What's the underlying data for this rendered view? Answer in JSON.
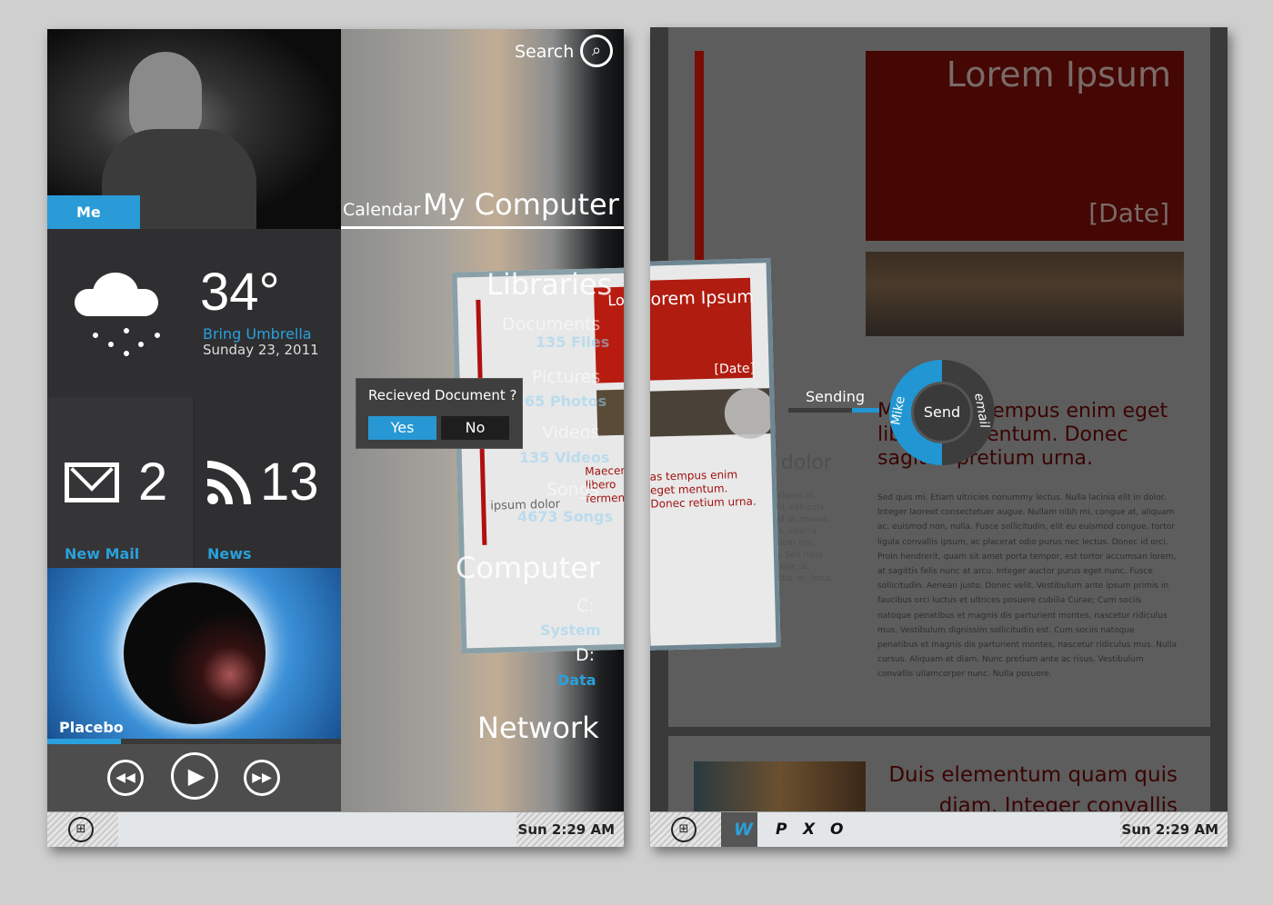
{
  "left_device": {
    "me_tile": {
      "label": "Me"
    },
    "weather": {
      "temperature": "34°",
      "tip": "Bring Umbrella",
      "date": "Sunday 23, 2011",
      "icon": "snow-cloud-icon"
    },
    "mail": {
      "count": "2",
      "label": "New Mail",
      "icon": "mail-icon"
    },
    "news": {
      "count": "13",
      "label": "News",
      "icon": "rss-icon"
    },
    "music": {
      "label": "Placebo",
      "progress_percent": 25
    },
    "search": {
      "label": "Search"
    },
    "header": {
      "calendar": "Calendar",
      "my_computer": "My Computer"
    },
    "libraries": {
      "title": "Libraries",
      "items": [
        {
          "name": "Documents",
          "count": "135 Files"
        },
        {
          "name": "Pictures",
          "count": "65 Photos"
        },
        {
          "name": "Videos",
          "count": "135 Videos"
        },
        {
          "name": "Songs",
          "count": "4673 Songs"
        }
      ]
    },
    "computer": {
      "title": "Computer",
      "drives": [
        {
          "name": "C:",
          "label": "System"
        },
        {
          "name": "D:",
          "label": "Data"
        }
      ]
    },
    "network": "Network",
    "dialog": {
      "question": "Recieved Document ?",
      "yes": "Yes",
      "no": "No"
    },
    "thumb": {
      "title": "Lorem Ipsum",
      "subhead": "Maecenas libero fermentum sagittis pretium",
      "side": "ipsum dolor"
    },
    "taskbar": {
      "clock": "Sun 2:29 AM"
    }
  },
  "right_device": {
    "doc": {
      "title": "Lorem Ipsum",
      "date": "[Date]",
      "heading": "Maecenas tempus enim eget libero fermentum. Donec sagittis pretium urna.",
      "side_heading": "ipsum dolor",
      "side_text": "aliquam ac, aliquet id, consequat sed, vehicula risus, euismod ut, massa. Nulla id lectus. viverra. Morbi vestibulum nisl, massa. lorem. Sed risus justo, scelerisque ut, ultrices a, auctor et, lacus. Duis a orci.",
      "body": "Sed quis mi. Etiam ultricies nonummy lectus. Nulla lacinia elit in dolor. Integer laoreet consectetuer augue. Nullam nibh mi, congue at, aliquam ac, euismod non, nulla. Fusce sollicitudin, elit eu euismod congue, tortor ligula convallis ipsum, ac placerat odio purus nec lectus. Donec id orci. Proin hendrerit, quam sit amet porta tempor, est tortor accumsan lorem, at sagittis felis nunc at arcu. Integer auctor purus eget nunc. Fusce sollicitudin. Aenean justo. Donec velit. Vestibulum ante ipsum primis in faucibus orci luctus et ultrices posuere cubilia Curae; Cum sociis natoque penatibus et magnis dis parturient montes, nascetur ridiculus mus. Vestibulum dignissim sollicitudin est. Cum sociis natoque penatibus et magnis dis parturient montes, nascetur ridiculus mus. Nulla cursus. Aliquam et diam. Nunc pretium ante ac risus. Vestibulum convallis ullamcorper nunc. Nulla posuere.",
      "next_heading": "Duis elementum quam quis diam. Integer convallis"
    },
    "float_doc": {
      "title": "orem Ipsum",
      "date": "[Date]",
      "heading": "as tempus enim eget mentum. Donec retium urna."
    },
    "send": {
      "status": "Sending",
      "progress_percent": 30,
      "center": "Send",
      "left_option": "Mike",
      "right_option": "email",
      "accent": "#2196d3"
    },
    "taskbar": {
      "apps": [
        "W",
        "P",
        "X",
        "O"
      ],
      "clock": "Sun 2:29 AM"
    }
  }
}
